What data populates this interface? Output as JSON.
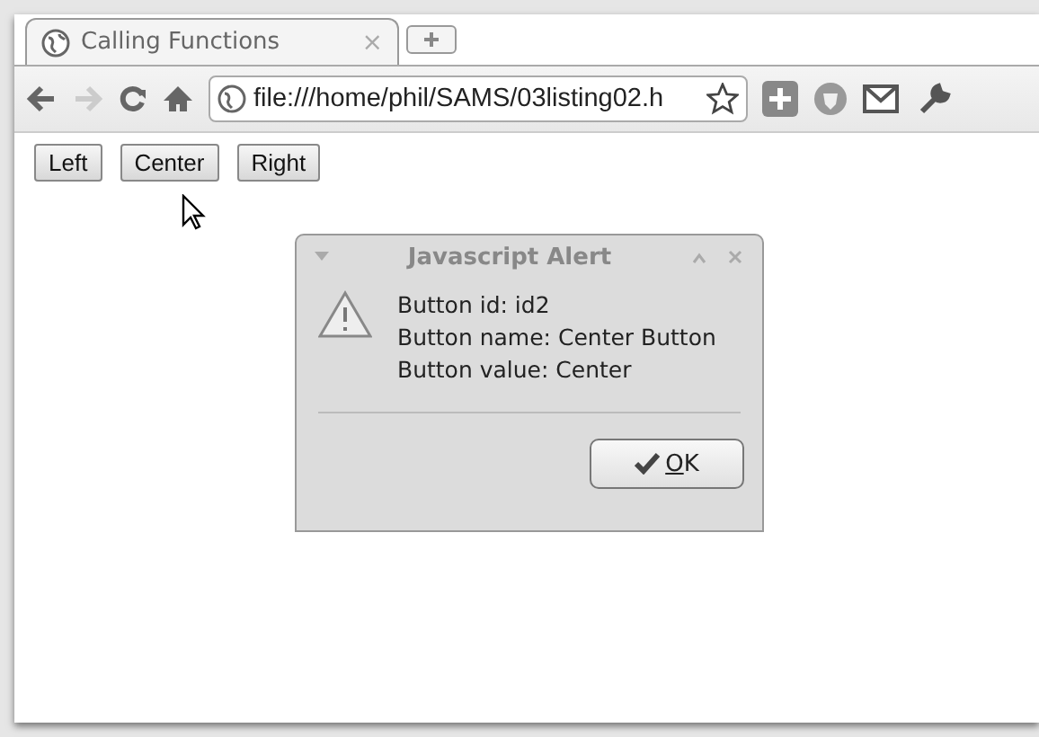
{
  "tabs": [
    {
      "label": "Calling Functions",
      "selected": true,
      "close": "×"
    }
  ],
  "address": {
    "value": "file:///home/phil/SAMS/03listing02.h"
  },
  "page_buttons": [
    {
      "label": "Left"
    },
    {
      "label": "Center"
    },
    {
      "label": "Right"
    }
  ],
  "alert": {
    "title": "Javascript Alert",
    "lines": [
      "Button id: id2",
      "Button name: Center Button",
      "Button value: Center"
    ],
    "button": "OK"
  }
}
